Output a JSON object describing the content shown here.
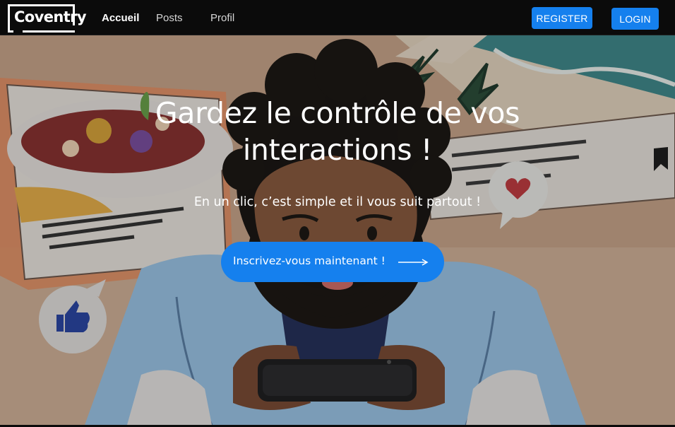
{
  "brand": {
    "name": "Coventry"
  },
  "nav": {
    "links": [
      {
        "label": "Accueil",
        "active": true
      },
      {
        "label": "Posts",
        "active": false
      },
      {
        "label": "Profil",
        "active": false
      }
    ],
    "register_label": "REGISTER",
    "login_label": "LOGIN"
  },
  "hero": {
    "title": "Gardez le contrôle de vos interactions !",
    "subtitle": "En un clic, c’est simple et il vous suit partout !",
    "cta_label": "Inscrivez-vous maintenant !",
    "cta_icon": "arrow-right-icon"
  },
  "colors": {
    "accent": "#1580ee",
    "navbar": "#0b0b0b"
  }
}
